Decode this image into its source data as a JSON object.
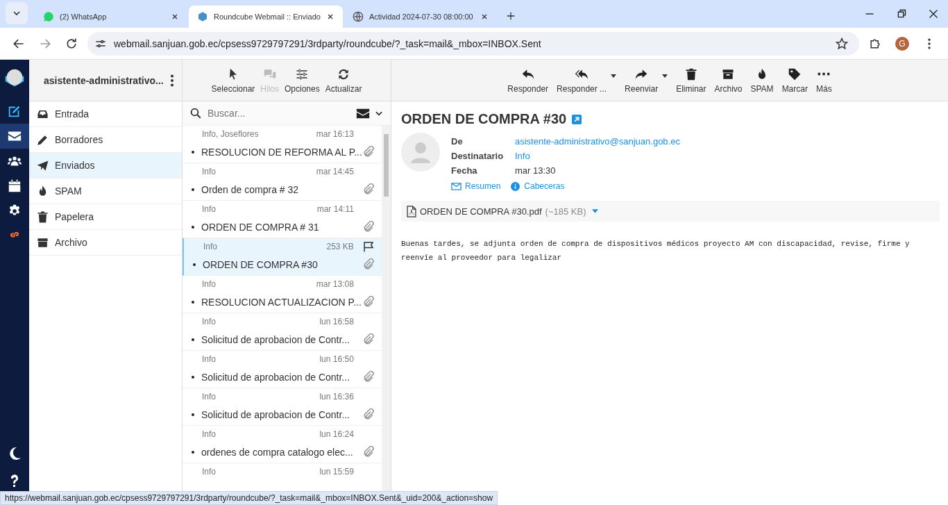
{
  "browser": {
    "tabs": [
      {
        "title": "(2) WhatsApp",
        "selected": false
      },
      {
        "title": "Roundcube Webmail :: Enviado",
        "selected": true
      },
      {
        "title": "Actividad 2024-07-30 08:00:00",
        "selected": false
      }
    ],
    "url": "webmail.sanjuan.gob.ec/cpsess9729797291/3rdparty/roundcube/?_task=mail&_mbox=INBOX.Sent",
    "profile": "G"
  },
  "rail": {
    "items": [
      {
        "selected": false
      },
      {
        "selected": true
      },
      {
        "selected": false
      },
      {
        "selected": false
      },
      {
        "selected": false
      }
    ]
  },
  "account": {
    "name": "asistente-administrativo..."
  },
  "folders": [
    {
      "label": "Entrada",
      "selected": false
    },
    {
      "label": "Borradores",
      "selected": false
    },
    {
      "label": "Enviados",
      "selected": true
    },
    {
      "label": "SPAM",
      "selected": false
    },
    {
      "label": "Papelera",
      "selected": false
    },
    {
      "label": "Archivo",
      "selected": false
    }
  ],
  "list_toolbar": [
    {
      "label": "Seleccionar",
      "disabled": false
    },
    {
      "label": "Hilos",
      "disabled": true
    },
    {
      "label": "Opciones",
      "disabled": false
    },
    {
      "label": "Actualizar",
      "disabled": false
    }
  ],
  "search": {
    "placeholder": "Buscar..."
  },
  "messages": [
    {
      "from": "Info, Joseflores",
      "meta": "mar 16:13",
      "subject": "RESOLUCION DE REFORMA AL P...",
      "selected": false,
      "flag": false
    },
    {
      "from": "Info",
      "meta": "mar 14:45",
      "subject": "Orden de compra # 32",
      "selected": false,
      "flag": false
    },
    {
      "from": "Info",
      "meta": "mar 14:11",
      "subject": "ORDEN DE COMPRA # 31",
      "selected": false,
      "flag": false
    },
    {
      "from": "Info",
      "meta": "253 KB",
      "subject": "ORDEN DE COMPRA #30",
      "selected": true,
      "flag": true
    },
    {
      "from": "Info",
      "meta": "mar 13:08",
      "subject": "RESOLUCION ACTUALIZACION P...",
      "selected": false,
      "flag": false
    },
    {
      "from": "Info",
      "meta": "lun 16:58",
      "subject": "Solicitud de aprobacion de Contr...",
      "selected": false,
      "flag": false
    },
    {
      "from": "Info",
      "meta": "lun 16:50",
      "subject": "Solicitud de aprobacion de Contr...",
      "selected": false,
      "flag": false
    },
    {
      "from": "Info",
      "meta": "lun 16:36",
      "subject": "Solicitud de aprobacion de Contr...",
      "selected": false,
      "flag": false
    },
    {
      "from": "Info",
      "meta": "lun 16:24",
      "subject": "ordenes de compra catalogo elec...",
      "selected": false,
      "flag": false
    },
    {
      "from": "Info",
      "meta": "lun 15:59",
      "flag": false,
      "selected": false
    }
  ],
  "mail_toolbar": [
    {
      "label": "Responder",
      "has_menu": false
    },
    {
      "label": "Responder ...",
      "has_menu": true
    },
    {
      "label": "Reenviar",
      "has_menu": true
    },
    {
      "label": "Eliminar",
      "has_menu": false
    },
    {
      "label": "Archivo",
      "has_menu": false
    },
    {
      "label": "SPAM",
      "has_menu": false
    },
    {
      "label": "Marcar",
      "has_menu": false
    },
    {
      "label": "Más",
      "has_menu": false
    }
  ],
  "message": {
    "subject": "ORDEN DE COMPRA #30",
    "headers": [
      {
        "label": "De",
        "value": "asistente-administrativo@sanjuan.gob.ec",
        "kind": "link"
      },
      {
        "label": "Destinatario",
        "value": "Info",
        "kind": "link"
      },
      {
        "label": "Fecha",
        "value": "mar 13:30",
        "kind": "text"
      }
    ],
    "links": [
      "Resumen",
      "Cabeceras"
    ],
    "attachment": {
      "name": "ORDEN DE COMPRA #30.pdf",
      "size": "(~185 KB)"
    },
    "body": "Buenas tardes, se adjunta orden de compra de dispositivos médicos proyecto AM con discapacidad, revise, firme y reenvíe al proveedor para legalizar"
  },
  "status_url": "https://webmail.sanjuan.gob.ec/cpsess9729797291/3rdparty/roundcube/?_task=mail&_mbox=INBOX.Sent&_uid=200&_action=show"
}
